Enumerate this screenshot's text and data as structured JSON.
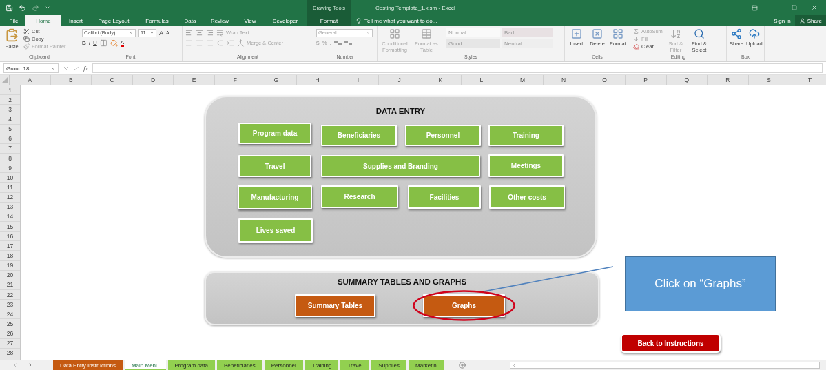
{
  "title_bar": {
    "context_group": "Drawing Tools",
    "title": "Costing Template_1.xlsm - Excel"
  },
  "ribbon_tabs": [
    {
      "label": "File",
      "selected": false,
      "kind": "file"
    },
    {
      "label": "Home",
      "selected": true,
      "kind": "standard"
    },
    {
      "label": "Insert",
      "selected": false,
      "kind": "standard"
    },
    {
      "label": "Page Layout",
      "selected": false,
      "kind": "standard"
    },
    {
      "label": "Formulas",
      "selected": false,
      "kind": "standard"
    },
    {
      "label": "Data",
      "selected": false,
      "kind": "standard"
    },
    {
      "label": "Review",
      "selected": false,
      "kind": "standard"
    },
    {
      "label": "View",
      "selected": false,
      "kind": "standard"
    },
    {
      "label": "Developer",
      "selected": false,
      "kind": "standard"
    },
    {
      "label": "Format",
      "selected": false,
      "kind": "contextual"
    }
  ],
  "tell_me": "Tell me what you want to do...",
  "account": {
    "sign_in": "Sign in",
    "share": "Share"
  },
  "ribbon": {
    "groups": [
      {
        "kind": "clipboard",
        "label": "Clipboard",
        "paste": "Paste",
        "items": [
          {
            "label": "Cut",
            "disabled": false
          },
          {
            "label": "Copy",
            "disabled": false
          },
          {
            "label": "Format Painter",
            "disabled": true
          }
        ]
      },
      {
        "kind": "font",
        "label": "Font",
        "font_name": "Calibri (Body)",
        "font_size": "11",
        "styles": [
          "B",
          "I",
          "U"
        ],
        "grow": "A",
        "shrink": "A",
        "font_color": "A"
      },
      {
        "kind": "alignment",
        "label": "Alignment",
        "items": [
          {
            "label": "Wrap Text",
            "disabled": true
          },
          {
            "label": "Merge & Center",
            "disabled": true
          }
        ]
      },
      {
        "kind": "number",
        "label": "Number",
        "format": "General",
        "symbols": [
          "$",
          "%",
          ","
        ]
      },
      {
        "kind": "styles",
        "label": "Styles",
        "commands": [
          {
            "label": "Conditional Formatting",
            "disabled": true
          },
          {
            "label": "Format as Table",
            "disabled": true
          }
        ],
        "cell_styles": [
          {
            "label": "Normal",
            "color": "#f9f9f9"
          },
          {
            "label": "Bad",
            "color": "#e8e1e3"
          },
          {
            "label": "Good",
            "color": "#e6e6e6"
          },
          {
            "label": "Neutral",
            "color": "#eeeeee"
          }
        ]
      },
      {
        "kind": "cells",
        "label": "Cells",
        "commands": [
          {
            "label": "Insert",
            "disabled": false
          },
          {
            "label": "Delete",
            "disabled": false
          },
          {
            "label": "Format",
            "disabled": false
          }
        ]
      },
      {
        "kind": "editing",
        "label": "Editing",
        "small": [
          {
            "label": "AutoSum",
            "disabled": true
          },
          {
            "label": "Fill",
            "disabled": true
          },
          {
            "label": "Clear",
            "disabled": false
          }
        ],
        "large": [
          {
            "label": "Sort & Filter",
            "disabled": true
          },
          {
            "label": "Find & Select",
            "disabled": false
          }
        ]
      },
      {
        "kind": "box",
        "label": "Box",
        "commands": [
          {
            "label": "Share",
            "disabled": false
          },
          {
            "label": "Upload",
            "disabled": false
          }
        ]
      }
    ]
  },
  "formula_bar": {
    "name_box": "Group 18",
    "function_label": "fx"
  },
  "sheet": {
    "columns": [
      "A",
      "B",
      "C",
      "D",
      "E",
      "F",
      "G",
      "H",
      "I",
      "J",
      "K",
      "L",
      "M",
      "N",
      "O",
      "P",
      "Q",
      "R",
      "S",
      "T"
    ],
    "rows": [
      "1",
      "2",
      "3",
      "4",
      "5",
      "6",
      "7",
      "8",
      "9",
      "10",
      "11",
      "12",
      "13",
      "14",
      "15",
      "16",
      "17",
      "18",
      "19",
      "20",
      "21",
      "22",
      "23",
      "24",
      "25",
      "26",
      "27",
      "28"
    ]
  },
  "data_entry": {
    "title": "DATA ENTRY",
    "buttons": [
      "Program data",
      "Beneficiaries",
      "Personnel",
      "Training",
      "Travel",
      "Supplies and Branding",
      "Meetings",
      "Manufacturing",
      "Research",
      "Facilities",
      "Other costs",
      "Lives saved"
    ]
  },
  "summary": {
    "title": "SUMMARY TABLES AND GRAPHS",
    "buttons": [
      {
        "label": "Summary Tables",
        "circled": false
      },
      {
        "label": "Graphs",
        "circled": true
      }
    ]
  },
  "callout": "Click on “Graphs”",
  "back_button": "Back to Instructions",
  "sheet_tabs": [
    {
      "label": "Data Entry Instructions",
      "selected": false,
      "color": "#c55a11"
    },
    {
      "label": "Main Menu",
      "selected": true,
      "color": "#92d050"
    },
    {
      "label": "Program data",
      "selected": false,
      "color": "#92d050"
    },
    {
      "label": "Beneficiaries",
      "selected": false,
      "color": "#92d050"
    },
    {
      "label": "Personnel",
      "selected": false,
      "color": "#92d050"
    },
    {
      "label": "Training",
      "selected": false,
      "color": "#92d050"
    },
    {
      "label": "Travel",
      "selected": false,
      "color": "#92d050"
    },
    {
      "label": "Supplies",
      "selected": false,
      "color": "#92d050"
    },
    {
      "label": "Marketin",
      "selected": false,
      "color": "#92d050"
    }
  ],
  "more_tabs": "..."
}
